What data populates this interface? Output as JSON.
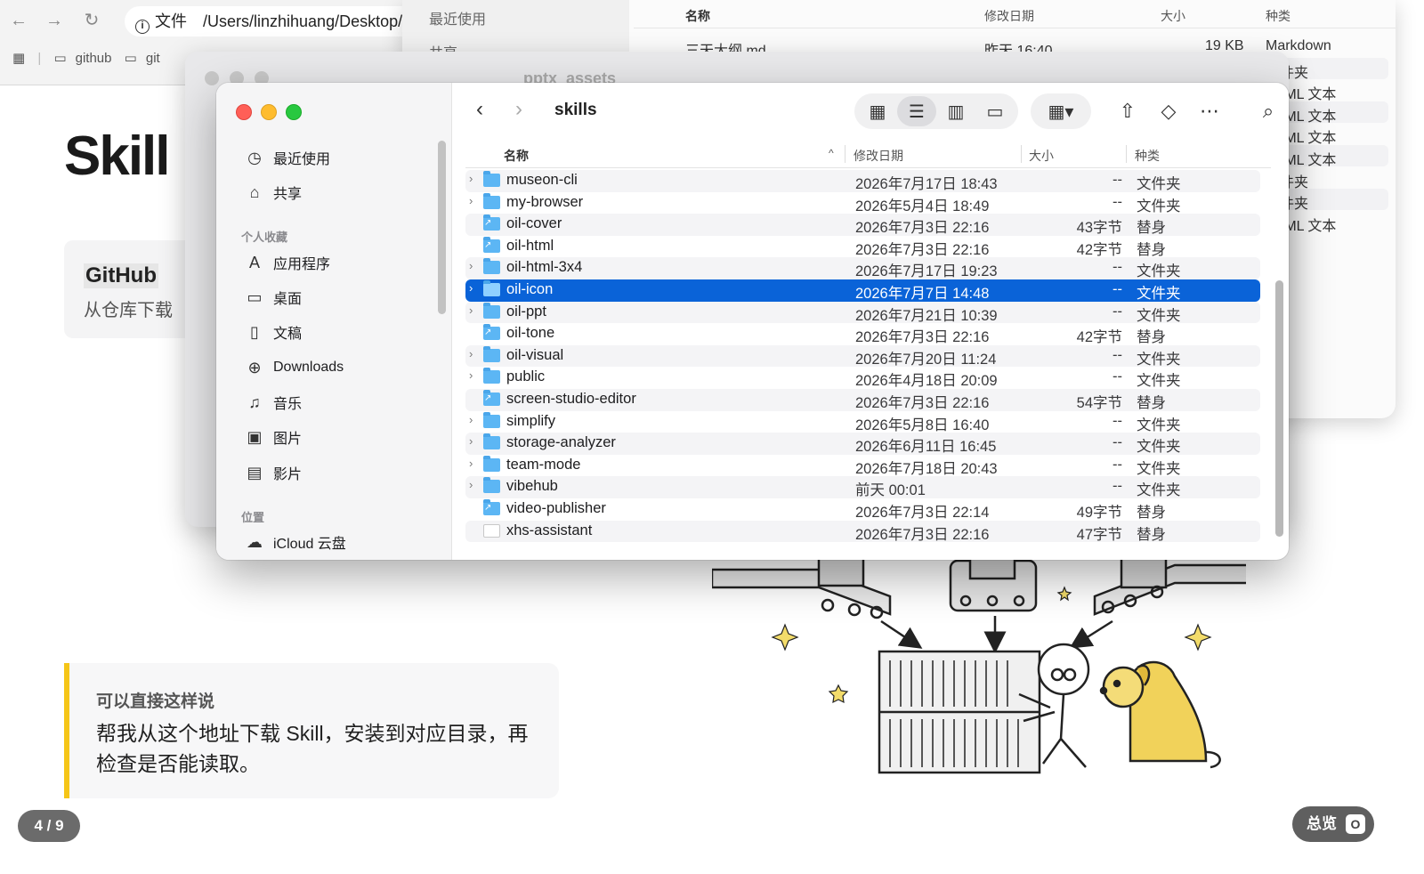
{
  "browser": {
    "file_label": "文件",
    "url": "/Users/linzhihuang/Desktop/",
    "bookmarks": [
      "github",
      "git"
    ]
  },
  "slide": {
    "title": "Skill",
    "github_card": {
      "title": "GitHub",
      "subtitle": "从仓库下载"
    },
    "quote": {
      "heading": "可以直接这样说",
      "body": "帮我从这个地址下载 Skill，安装到对应目录，再检查是否能读取。"
    },
    "page_indicator": "4 / 9",
    "overview_label": "总览",
    "overview_key": "O"
  },
  "back_finder": {
    "sidebar": [
      "最近使用",
      "共享"
    ],
    "headers": {
      "name": "名称",
      "date": "修改日期",
      "size": "大小",
      "kind": "种类"
    },
    "rows": [
      {
        "name": "三天大纲.md",
        "date": "昨天 16:40",
        "size": "19 KB",
        "kind": "Markdown"
      },
      {
        "name": "",
        "date": "",
        "size": "",
        "kind": "文件夹"
      },
      {
        "name": "",
        "date": "",
        "size": "",
        "kind": "HTML 文本"
      },
      {
        "name": "",
        "date": "",
        "size": "",
        "kind": "HTML 文本"
      },
      {
        "name": "",
        "date": "",
        "size": "",
        "kind": "HTML 文本"
      },
      {
        "name": "",
        "date": "",
        "size": "",
        "kind": "HTML 文本"
      },
      {
        "name": "",
        "date": "",
        "size": "",
        "kind": "文件夹"
      },
      {
        "name": "",
        "date": "",
        "size": "",
        "kind": "文件夹"
      },
      {
        "name": "",
        "date": "",
        "size": "",
        "kind": "HTML 文本"
      }
    ]
  },
  "mid_finder": {
    "title": "pptx_assets"
  },
  "finder": {
    "title": "skills",
    "sidebar": {
      "top_items": [
        {
          "label": "最近使用",
          "icon": "clock-icon"
        },
        {
          "label": "共享",
          "icon": "shared-folder-icon"
        }
      ],
      "favorites_label": "个人收藏",
      "favorites": [
        {
          "label": "应用程序",
          "icon": "applications-icon"
        },
        {
          "label": "桌面",
          "icon": "desktop-icon"
        },
        {
          "label": "文稿",
          "icon": "document-icon"
        },
        {
          "label": "Downloads",
          "icon": "download-icon"
        },
        {
          "label": "音乐",
          "icon": "music-icon"
        },
        {
          "label": "图片",
          "icon": "photo-icon"
        },
        {
          "label": "影片",
          "icon": "film-icon"
        }
      ],
      "locations_label": "位置",
      "locations": [
        {
          "label": "iCloud 云盘",
          "icon": "cloud-icon"
        }
      ]
    },
    "headers": {
      "name": "名称",
      "date": "修改日期",
      "size": "大小",
      "kind": "种类"
    },
    "rows": [
      {
        "name": "museon-cli",
        "date": "2026年7月17日 18:43",
        "size": "--",
        "kind": "文件夹",
        "type": "folder"
      },
      {
        "name": "my-browser",
        "date": "2026年5月4日 18:49",
        "size": "--",
        "kind": "文件夹",
        "type": "folder"
      },
      {
        "name": "oil-cover",
        "date": "2026年7月3日 22:16",
        "size": "43字节",
        "kind": "替身",
        "type": "alias"
      },
      {
        "name": "oil-html",
        "date": "2026年7月3日 22:16",
        "size": "42字节",
        "kind": "替身",
        "type": "alias"
      },
      {
        "name": "oil-html-3x4",
        "date": "2026年7月17日 19:23",
        "size": "--",
        "kind": "文件夹",
        "type": "folder"
      },
      {
        "name": "oil-icon",
        "date": "2026年7月7日 14:48",
        "size": "--",
        "kind": "文件夹",
        "type": "folder",
        "selected": true
      },
      {
        "name": "oil-ppt",
        "date": "2026年7月21日 10:39",
        "size": "--",
        "kind": "文件夹",
        "type": "folder"
      },
      {
        "name": "oil-tone",
        "date": "2026年7月3日 22:16",
        "size": "42字节",
        "kind": "替身",
        "type": "alias"
      },
      {
        "name": "oil-visual",
        "date": "2026年7月20日 11:24",
        "size": "--",
        "kind": "文件夹",
        "type": "folder"
      },
      {
        "name": "public",
        "date": "2026年4月18日 20:09",
        "size": "--",
        "kind": "文件夹",
        "type": "folder"
      },
      {
        "name": "screen-studio-editor",
        "date": "2026年7月3日 22:16",
        "size": "54字节",
        "kind": "替身",
        "type": "alias"
      },
      {
        "name": "simplify",
        "date": "2026年5月8日 16:40",
        "size": "--",
        "kind": "文件夹",
        "type": "folder"
      },
      {
        "name": "storage-analyzer",
        "date": "2026年6月11日 16:45",
        "size": "--",
        "kind": "文件夹",
        "type": "folder"
      },
      {
        "name": "team-mode",
        "date": "2026年7月18日 20:43",
        "size": "--",
        "kind": "文件夹",
        "type": "folder"
      },
      {
        "name": "vibehub",
        "date": "前天 00:01",
        "size": "--",
        "kind": "文件夹",
        "type": "folder"
      },
      {
        "name": "video-publisher",
        "date": "2026年7月3日 22:14",
        "size": "49字节",
        "kind": "替身",
        "type": "alias"
      },
      {
        "name": "xhs-assistant",
        "date": "2026年7月3日 22:16",
        "size": "47字节",
        "kind": "替身",
        "type": "file"
      }
    ]
  },
  "colors": {
    "selection": "#0a63d8",
    "folder": "#5cb6f4",
    "quote_accent": "#f5c518",
    "close": "#ff5f57",
    "minimize": "#febc2e",
    "zoom": "#28c840"
  }
}
